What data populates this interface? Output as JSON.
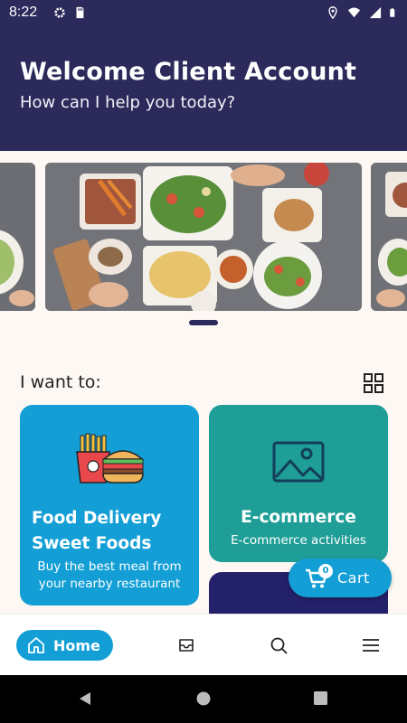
{
  "status_bar": {
    "time": "8:22",
    "left_icons": [
      "gear-icon",
      "sd-card-icon"
    ],
    "right_icons": [
      "location-icon",
      "wifi-icon",
      "signal-icon",
      "battery-icon"
    ]
  },
  "header": {
    "title": "Welcome Client Account",
    "subtitle": "How can I help you today?"
  },
  "carousel": {
    "active_index": 1
  },
  "section": {
    "title": "I want to:",
    "view_toggle_icon": "grid-icon"
  },
  "cards": {
    "food": {
      "title_line1": "Food Delivery",
      "title_line2": "Sweet Foods",
      "desc_line1": "Buy the best meal from",
      "desc_line2": "your nearby restaurant",
      "icon": "fries-burger-icon"
    },
    "ecommerce": {
      "title": "E-commerce",
      "desc": "E-commerce activities",
      "icon": "image-icon"
    }
  },
  "cart": {
    "label": "Cart",
    "count": "0"
  },
  "bottom_nav": {
    "home_label": "Home",
    "items": [
      "home-icon",
      "inbox-icon",
      "search-icon",
      "menu-icon"
    ]
  },
  "colors": {
    "header_bg": "#2b2a5a",
    "food_card": "#139fd6",
    "ecom_card": "#1f9e97",
    "dark_card": "#24216b",
    "accent": "#139fd6",
    "page_bg": "#fdf8f3"
  }
}
